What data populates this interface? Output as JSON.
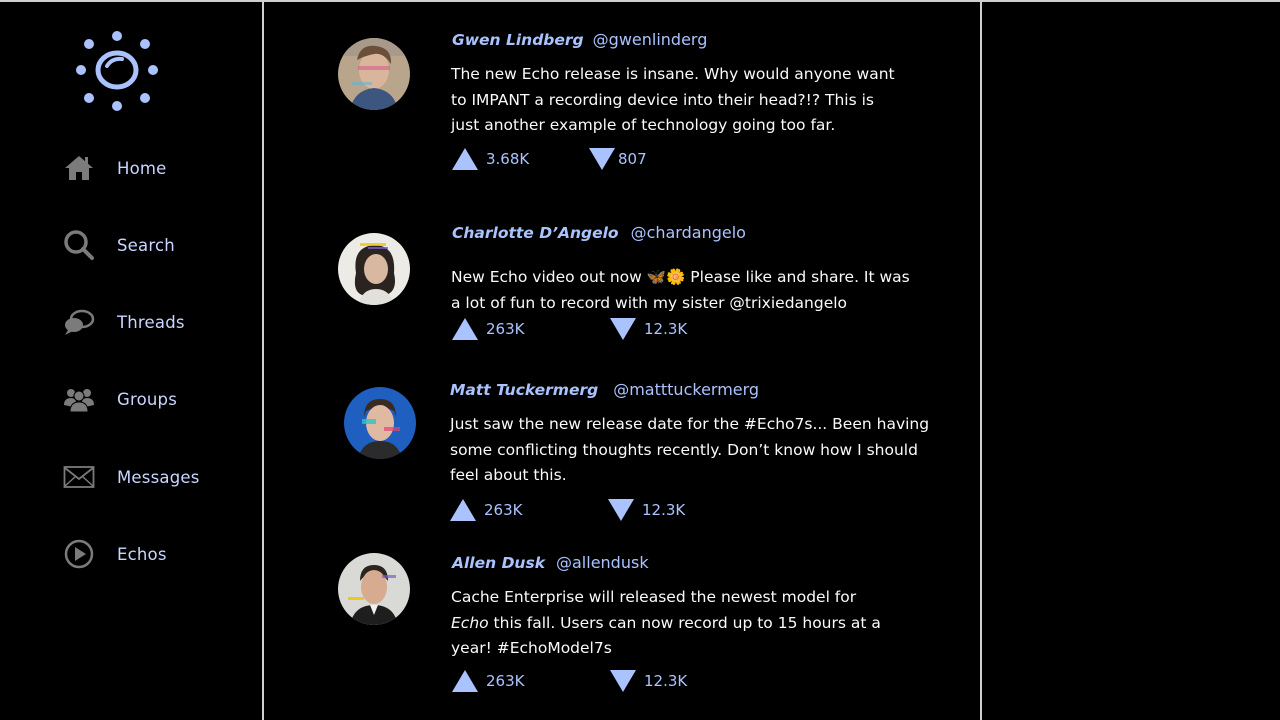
{
  "colors": {
    "accent": "#aac3ff",
    "background": "#000000",
    "divider": "#cfcfcf"
  },
  "nav": [
    {
      "label": "Home",
      "icon": "home-icon"
    },
    {
      "label": "Search",
      "icon": "search-icon"
    },
    {
      "label": "Threads",
      "icon": "chat-bubbles-icon"
    },
    {
      "label": "Groups",
      "icon": "group-icon"
    },
    {
      "label": "Messages",
      "icon": "envelope-icon"
    },
    {
      "label": "Echos",
      "icon": "play-circle-icon"
    }
  ],
  "posts": [
    {
      "author": "Gwen Lindberg",
      "handle": "@gwenlinderg",
      "text": "The new Echo release is insane. Why would anyone want to IMPANT a recording device into their head?!? This is just another example of technology going too far.",
      "upvotes": "3.68K",
      "downvotes": "807"
    },
    {
      "author": "Charlotte D’Angelo",
      "handle": "@chardangelo",
      "text": "New Echo video out now 🦋🌼 Please like and share. It was a lot of fun to record with my sister @trixiedangelo",
      "upvotes": "263K",
      "downvotes": "12.3K"
    },
    {
      "author": "Matt Tuckermerg",
      "handle": "@matttuckermerg",
      "text": "Just saw the new release date for the #Echo7s... Been having some conflicting thoughts recently. Don’t know how I should feel about this.",
      "upvotes": "263K",
      "downvotes": "12.3K"
    },
    {
      "author": "Allen Dusk",
      "handle": "@allendusk",
      "text_before": "Cache Enterprise will released the newest model for ",
      "text_em": "Echo",
      "text_after": " this fall. Users can now record up to 15 hours at a year! #EchoModel7s",
      "upvotes": "263K",
      "downvotes": "12.3K"
    }
  ]
}
